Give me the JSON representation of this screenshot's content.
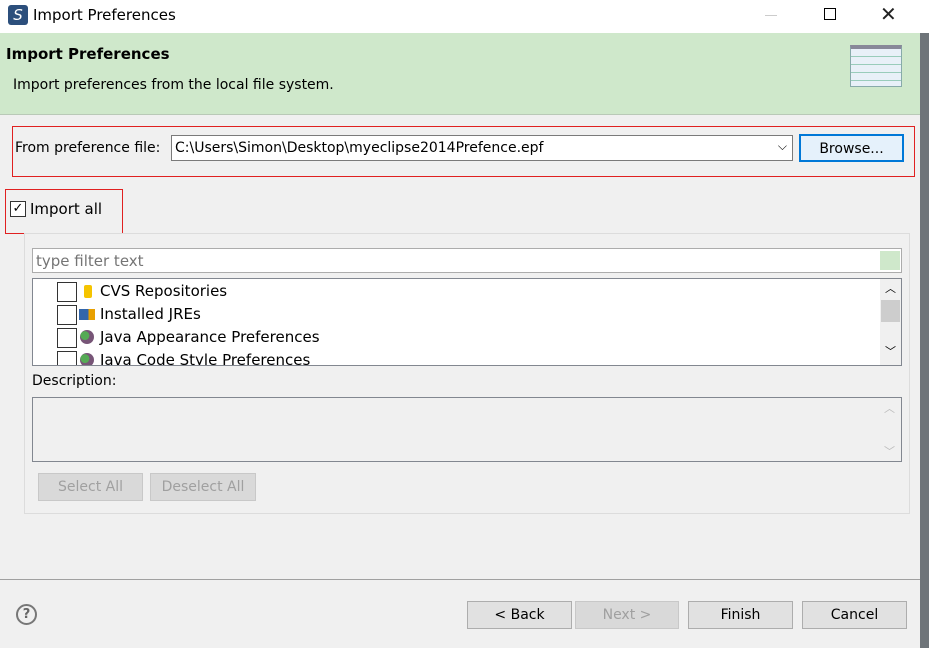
{
  "window": {
    "title": "Import Preferences"
  },
  "banner": {
    "title": "Import Preferences",
    "description": "Import preferences from the local file system."
  },
  "file": {
    "label": "From preference file:",
    "value": "C:\\Users\\Simon\\Desktop\\myeclipse2014Prefence.epf",
    "browse": "Browse..."
  },
  "import_all": {
    "label": "Import all",
    "checked": true
  },
  "filter": {
    "placeholder": "type filter text"
  },
  "tree": {
    "items": [
      {
        "label": "CVS Repositories",
        "icon": "database-icon",
        "checked": false
      },
      {
        "label": "Installed JREs",
        "icon": "jre-icon",
        "checked": false
      },
      {
        "label": "Java Appearance Preferences",
        "icon": "java-prefs-icon",
        "checked": false
      },
      {
        "label": "Java Code Style Preferences",
        "icon": "java-prefs-icon",
        "checked": false
      }
    ]
  },
  "description": {
    "label": "Description:",
    "value": ""
  },
  "select_all": "Select All",
  "deselect_all": "Deselect All",
  "footer": {
    "back": "< Back",
    "next": "Next >",
    "finish": "Finish",
    "cancel": "Cancel"
  },
  "colors": {
    "banner": "#cfe8cb",
    "annotation": "#e02020",
    "default_button": "#0078d7"
  }
}
